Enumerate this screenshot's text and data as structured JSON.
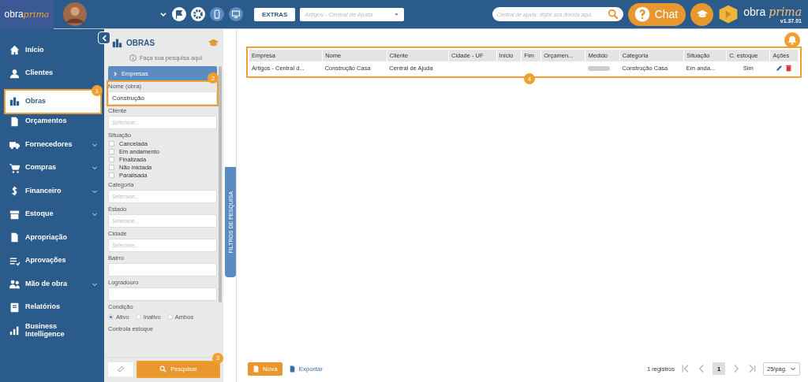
{
  "header": {
    "logo": {
      "word": "obra",
      "script": "prima"
    },
    "extras": "EXTRAS",
    "company_select": {
      "placeholder": "Artigos - Central de Ajuda"
    },
    "help_search": {
      "placeholder": "Central de ajuda: digite sua dúvida aqui..."
    },
    "chat": "Chat",
    "brand": {
      "word": "obra",
      "script": "prima",
      "version": "v1.37.01"
    }
  },
  "sidebar": {
    "items": [
      {
        "kind": "home",
        "label": "Início",
        "selected": false,
        "expandable": false
      },
      {
        "kind": "user",
        "label": "Clientes",
        "selected": false,
        "expandable": false
      },
      {
        "kind": "buildings",
        "label": "Obras",
        "selected": true,
        "expandable": false,
        "callout": "1"
      },
      {
        "kind": "doc",
        "label": "Orçamentos",
        "selected": false,
        "expandable": false
      },
      {
        "kind": "truck",
        "label": "Fornecedores",
        "selected": false,
        "expandable": true
      },
      {
        "kind": "cart",
        "label": "Compras",
        "selected": false,
        "expandable": true
      },
      {
        "kind": "dollar",
        "label": "Financeiro",
        "selected": false,
        "expandable": true
      },
      {
        "kind": "box",
        "label": "Estoque",
        "selected": false,
        "expandable": true
      },
      {
        "kind": "doc",
        "label": "Apropriação",
        "selected": false,
        "expandable": false
      },
      {
        "kind": "list",
        "label": "Aprovações",
        "selected": false,
        "expandable": false
      },
      {
        "kind": "users",
        "label": "Mão de obra",
        "selected": false,
        "expandable": true
      },
      {
        "kind": "book",
        "label": "Relatórios",
        "selected": false,
        "expandable": false
      },
      {
        "kind": "chart",
        "label": "Business Intelligence",
        "selected": false,
        "expandable": false
      }
    ]
  },
  "filters": {
    "title": "OBRAS",
    "hint": "Faça sua pesquisa aqui",
    "section": "Empresas",
    "fields": [
      {
        "kind": "text",
        "label": "Nome (obra)",
        "value": "Construção",
        "callout": "2"
      },
      {
        "kind": "select",
        "label": "Cliente",
        "placeholder": "Selecione..."
      },
      {
        "kind": "checks",
        "label": "Situação",
        "options": [
          {
            "label": "Cancelada",
            "checked": false
          },
          {
            "label": "Em andamento",
            "checked": false
          },
          {
            "label": "Finalizada",
            "checked": false
          },
          {
            "label": "Não iniciada",
            "checked": false
          },
          {
            "label": "Paralisada",
            "checked": false
          }
        ]
      },
      {
        "kind": "select",
        "label": "Categoria",
        "placeholder": "Selecione..."
      },
      {
        "kind": "select",
        "label": "Estado",
        "placeholder": "Selecione..."
      },
      {
        "kind": "select",
        "label": "Cidade",
        "placeholder": "Selecione..."
      },
      {
        "kind": "text",
        "label": "Bairro"
      },
      {
        "kind": "text",
        "label": "Logradouro"
      },
      {
        "kind": "radios",
        "label": "Condição",
        "options": [
          {
            "label": "Ativo",
            "selected": true
          },
          {
            "label": "Inativo",
            "selected": false
          },
          {
            "label": "Ambos",
            "selected": false
          }
        ]
      },
      {
        "kind": "label",
        "label": "Controla estoque"
      }
    ],
    "search_button": {
      "label": "Pesquisar",
      "callout": "3"
    },
    "side_tab": "FILTROS DE PESQUISA"
  },
  "table": {
    "callout": "4",
    "columns": [
      "Empresa",
      "Nome",
      "Cliente",
      "Cidade - UF",
      "Início",
      "Fim",
      "Orçamen...",
      "Medido",
      "Categoria",
      "Situação",
      "C. estoque",
      "Ações"
    ],
    "rows": [
      {
        "cells": [
          "Artigos - Central d...",
          "Construção Casa",
          "Central de Ajuda",
          "",
          "",
          "",
          "",
          null,
          "Construção Casa",
          "Em anda...",
          "Sim",
          null
        ],
        "medido": {
          "level": 0
        }
      }
    ]
  },
  "footer": {
    "new_button": "Nova",
    "export": "Exportar",
    "count": "1 registros",
    "pages": [
      {
        "label": "1",
        "selected": true
      }
    ],
    "page_size": "25/pág."
  }
}
